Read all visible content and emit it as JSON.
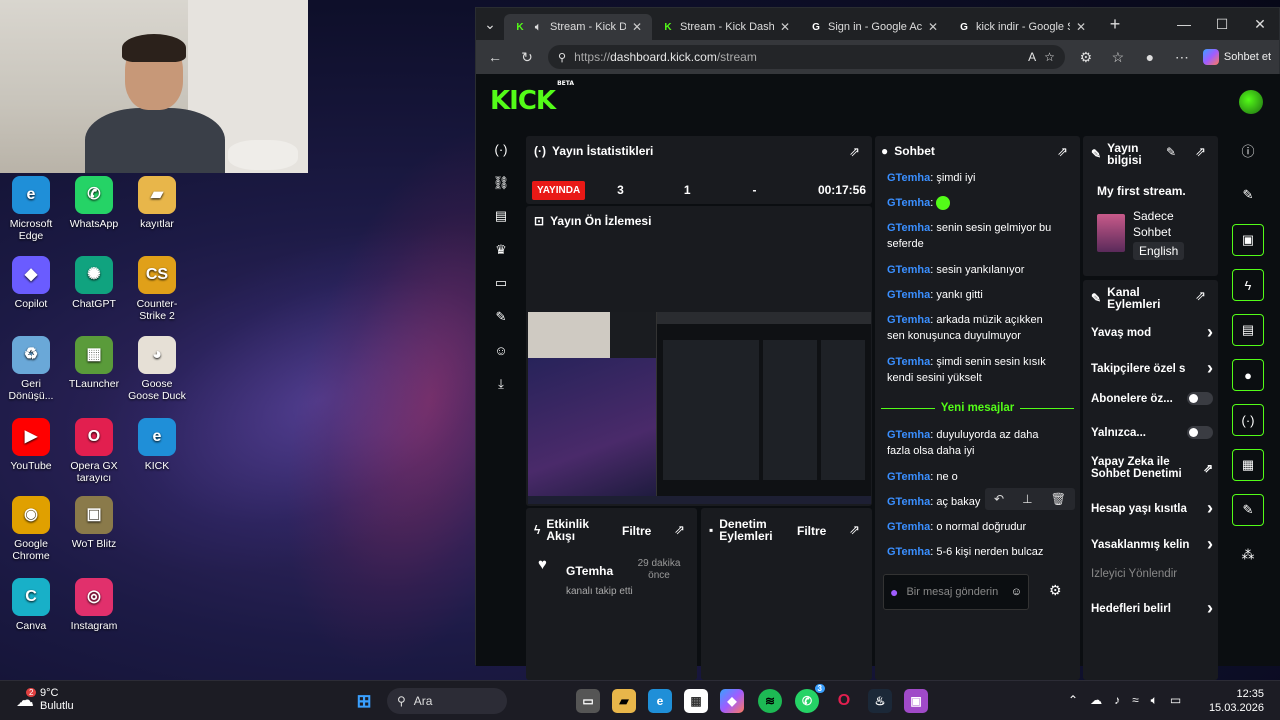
{
  "desktop": {
    "icons": [
      {
        "label": "Microsoft Edge",
        "glyph": "e",
        "color": "#1f8fd8"
      },
      {
        "label": "WhatsApp",
        "glyph": "✆",
        "color": "#25d366"
      },
      {
        "label": "kayıtlar",
        "glyph": "▰",
        "color": "#e8b64a"
      },
      {
        "label": "Copilot",
        "glyph": "◆",
        "color": "#6a5cff"
      },
      {
        "label": "ChatGPT",
        "glyph": "✺",
        "color": "#10a37f"
      },
      {
        "label": "Counter-Strike 2",
        "glyph": "CS",
        "color": "#e0a019"
      },
      {
        "label": "Geri Dönüşü...",
        "glyph": "♻",
        "color": "#6aa8d8"
      },
      {
        "label": "TLauncher",
        "glyph": "▦",
        "color": "#5a9b3a"
      },
      {
        "label": "Goose Goose Duck",
        "glyph": "◕",
        "color": "#e6e0d6"
      },
      {
        "label": "YouTube",
        "glyph": "▶",
        "color": "#ff0000"
      },
      {
        "label": "Opera GX tarayıcı",
        "glyph": "O",
        "color": "#e21f4f"
      },
      {
        "label": "KICK",
        "glyph": "e",
        "color": "#1f8fd8"
      },
      {
        "label": "Google Chrome",
        "glyph": "◉",
        "color": "#e0a000"
      },
      {
        "label": "WoT Blitz",
        "glyph": "▣",
        "color": "#8a7a4a"
      },
      {
        "label": "Canva",
        "glyph": "C",
        "color": "#18b0c8"
      },
      {
        "label": "Instagram",
        "glyph": "◎",
        "color": "#e1306c"
      }
    ]
  },
  "browser": {
    "tabs": [
      {
        "title": "Stream - Kick Dashboard",
        "icon": "kick-icon"
      },
      {
        "title": "Stream - Kick Dashboard",
        "icon": "kick-icon"
      },
      {
        "title": "Sign in - Google Accounts",
        "icon": "google-icon"
      },
      {
        "title": "kick indir - Google Search",
        "icon": "google-icon"
      }
    ],
    "url_prefix": "https://",
    "url_host": "dashboard.kick.com",
    "url_path": "/stream",
    "copilot_label": "Sohbet et"
  },
  "kick": {
    "logo": "KICK",
    "logo_badge": "BETA",
    "stats": {
      "title": "Yayın İstatistikleri",
      "live_badge": "YAYINDA",
      "viewers": "3",
      "followers": "1",
      "subs": "-",
      "duration": "00:17:56"
    },
    "preview": {
      "title": "Yayın Ön İzlemesi"
    },
    "activity": {
      "title": "Etkinlik Akışı",
      "filter": "Filtre",
      "user": "GTemha",
      "time": "29 dakika önce",
      "text": "kanalı takip etti"
    },
    "moderation": {
      "title": "Denetim Eylemleri",
      "filter": "Filtre"
    },
    "chat": {
      "title": "Sohbet",
      "messages": [
        {
          "user": "GTemha",
          "text": "şimdi iyi"
        },
        {
          "user": "GTemha",
          "text": ""
        },
        {
          "user": "GTemha",
          "text": "senin sesin gelmiyor bu seferde"
        },
        {
          "user": "GTemha",
          "text": "sesin yankılanıyor"
        },
        {
          "user": "GTemha",
          "text": "yankı gitti"
        },
        {
          "user": "GTemha",
          "text": "arkada müzik açıkken sen konuşunca duyulmuyor"
        },
        {
          "user": "GTemha",
          "text": "şimdi senin sesin kısık kendi sesini yükselt"
        }
      ],
      "new_messages_label": "Yeni mesajlar",
      "new_messages": [
        {
          "user": "GTemha",
          "text": "duyuluyorda az daha fazla olsa daha iyi"
        },
        {
          "user": "GTemha",
          "text": "ne o"
        },
        {
          "user": "GTemha",
          "text": "aç bakay"
        },
        {
          "user": "GTemha",
          "text": "o normal doğrudur"
        },
        {
          "user": "GTemha",
          "text": "5-6 kişi nerden bulcaz"
        }
      ],
      "input_placeholder": "Bir mesaj gönderin"
    },
    "stream_info": {
      "title": "Yayın bilgisi",
      "stream_title": "My first stream.",
      "category": "Sadece Sohbet",
      "language": "English"
    },
    "channel_actions": {
      "title": "Kanal Eylemleri",
      "items": [
        {
          "label": "Yavaş mod",
          "control": "arrow"
        },
        {
          "label": "Takipçilere özel s",
          "control": "arrow"
        },
        {
          "label": "Abonelere öz...",
          "control": "toggle"
        },
        {
          "label": "Yalnızca...",
          "control": "toggle"
        },
        {
          "label": "Yapay Zeka ile Sohbet Denetimi",
          "control": "external"
        },
        {
          "label": "Hesap yaşı kısıtla",
          "control": "arrow"
        },
        {
          "label": "Yasaklanmış kelin",
          "control": "arrow"
        },
        {
          "label": "İzleyici Yönlendir",
          "control": "none"
        },
        {
          "label": "Hedefleri belirl",
          "control": "arrow"
        }
      ]
    }
  },
  "taskbar": {
    "weather_temp": "9°C",
    "weather_text": "Bulutlu",
    "weather_badge": "2",
    "search_label": "Ara",
    "whatsapp_badge": "3",
    "time": "12:35",
    "date": "15.03.2026"
  },
  "colors": {
    "kick_green": "#53fc18",
    "live_red": "#e91916",
    "chat_user": "#3a8fff"
  }
}
